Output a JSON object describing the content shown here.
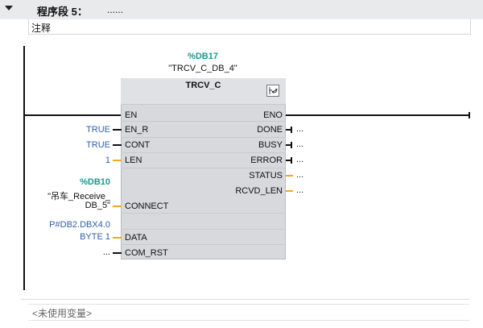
{
  "network": {
    "title": "程序段 5：",
    "title_suffix": "......",
    "comment": "注释"
  },
  "block": {
    "db_address": "%DB17",
    "db_name": "\"TRCV_C_DB_4\"",
    "type": "TRCV_C",
    "icon": "connection-icon"
  },
  "inputs": {
    "en": {
      "pin": "EN"
    },
    "en_r": {
      "pin": "EN_R",
      "value": "TRUE"
    },
    "cont": {
      "pin": "CONT",
      "value": "TRUE"
    },
    "len": {
      "pin": "LEN",
      "value": "1"
    },
    "connect": {
      "pin": "CONNECT",
      "db_address": "%DB10",
      "name_line1": "\"吊车_Receive_",
      "name_line2": "DB_5\""
    },
    "data": {
      "pin": "DATA",
      "value_line1": "P#DB2.DBX4.0",
      "value_line2": "BYTE 1"
    },
    "com_rst": {
      "pin": "COM_RST",
      "value": "..."
    }
  },
  "outputs": {
    "eno": {
      "pin": "ENO"
    },
    "done": {
      "pin": "DONE",
      "value": "..."
    },
    "busy": {
      "pin": "BUSY",
      "value": "..."
    },
    "error": {
      "pin": "ERROR",
      "value": "..."
    },
    "status": {
      "pin": "STATUS",
      "value": "..."
    },
    "rcvd_len": {
      "pin": "RCVD_LEN",
      "value": "..."
    }
  },
  "footer": {
    "unused": "<未使用变量>"
  },
  "colors": {
    "wire": "#111111",
    "word_connection": "#f5a623",
    "constant": "#2f5fae",
    "db_address": "#1a9a8c",
    "block_fill": "#d7d9dd"
  }
}
